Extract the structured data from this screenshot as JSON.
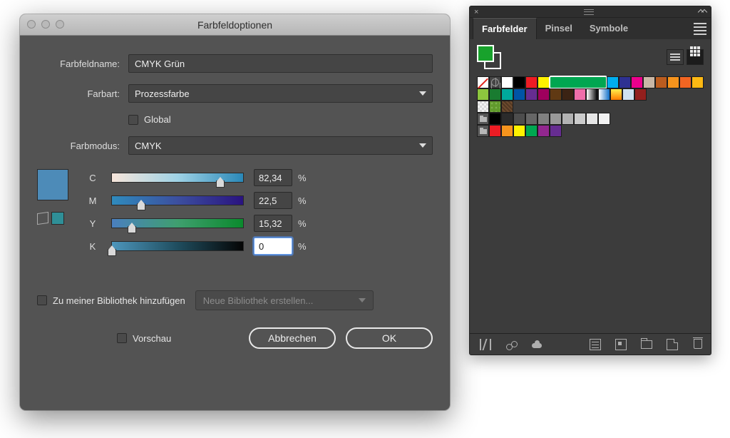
{
  "dialog": {
    "title": "Farbfeldoptionen",
    "name_label": "Farbfeldname:",
    "name_value": "CMYK Grün",
    "type_label": "Farbart:",
    "type_value": "Prozessfarbe",
    "global_label": "Global",
    "mode_label": "Farbmodus:",
    "mode_value": "CMYK",
    "channels": {
      "c": {
        "label": "C",
        "value": "82,34",
        "pos": 82.34
      },
      "m": {
        "label": "M",
        "value": "22,5",
        "pos": 22.5
      },
      "y": {
        "label": "Y",
        "value": "15,32",
        "pos": 15.32
      },
      "k": {
        "label": "K",
        "value": "0",
        "pos": 0
      }
    },
    "library_add_label": "Zu meiner Bibliothek hinzufügen",
    "library_select": "Neue Bibliothek erstellen...",
    "preview_label": "Vorschau",
    "cancel": "Abbrechen",
    "ok": "OK"
  },
  "panel": {
    "tabs": [
      "Farbfelder",
      "Pinsel",
      "Symbole"
    ],
    "active_tab": 0,
    "fill_color": "#18a22c",
    "rows": [
      [
        "none",
        "reg",
        "#ffffff",
        "#000000",
        "#ed1c24",
        "#fff200",
        "#00a651",
        "#00aeef",
        "#2e3192",
        "#ec008c",
        "#c9b7a6",
        "#bb5c1f",
        "#f7941d",
        "#f26522",
        "#fdb913"
      ],
      [
        "#8dc63e",
        "#197b30",
        "#00a99d",
        "#0054a6",
        "#662d91",
        "#9e005d",
        "#603913",
        "#3b2314",
        "#f06eaa",
        "gradK",
        "gradS",
        "gradSun",
        "#d0e2f0",
        "#931f1d"
      ],
      [
        "patA",
        "patB",
        "patC"
      ],
      [
        "folder",
        "#000000",
        "#2b2b2b",
        "#4d4d4d",
        "#666666",
        "#808080",
        "#999999",
        "#b3b3b3",
        "#cccccc",
        "#e6e6e6",
        "#f2f2f2"
      ],
      [
        "folder",
        "#ed1c24",
        "#f7941d",
        "#fff200",
        "#00a651",
        "#92278f",
        "#662d91"
      ]
    ],
    "selected": [
      0,
      6
    ]
  }
}
